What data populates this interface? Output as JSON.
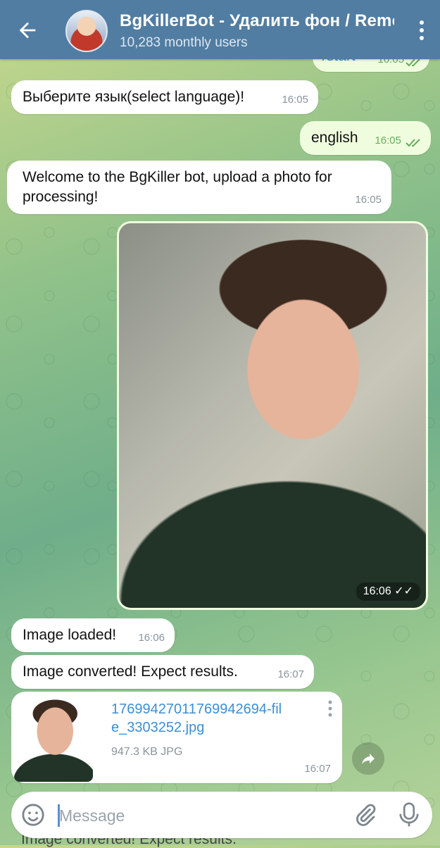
{
  "header": {
    "title": "BgKillerBot - Удалить фон / Remove background",
    "subtitle": "10,283 monthly users"
  },
  "messages": [
    {
      "id": "m0",
      "dir": "out",
      "text": "/start",
      "time": "16:05"
    },
    {
      "id": "m1",
      "dir": "in",
      "text": "Выберите язык(select language)!",
      "time": "16:05"
    },
    {
      "id": "m2",
      "dir": "out",
      "text": "english",
      "time": "16:05"
    },
    {
      "id": "m3",
      "dir": "in",
      "text": "Welcome to the BgKiller bot, upload a photo for processing!",
      "time": "16:05"
    },
    {
      "id": "m4",
      "dir": "out",
      "type": "photo",
      "time": "16:06"
    },
    {
      "id": "m5",
      "dir": "in",
      "text": "Image loaded!",
      "time": "16:06"
    },
    {
      "id": "m6",
      "dir": "in",
      "text": "Image converted! Expect results.",
      "time": "16:07"
    },
    {
      "id": "m7",
      "dir": "in",
      "type": "file",
      "filename": "17699427011769942694-file_3303252.jpg",
      "filename_line1": "17699427011769942694-fil",
      "filename_line2": "e_3303252.jpg",
      "meta": "947.3 KB JPG",
      "time": "16:07"
    }
  ],
  "partial_message": "Image converted! Expect results.",
  "input": {
    "placeholder": "Message"
  },
  "colors": {
    "header": "#517da2",
    "out_bubble": "#effdde",
    "in_bubble": "#ffffff",
    "link": "#3a8fd6"
  }
}
